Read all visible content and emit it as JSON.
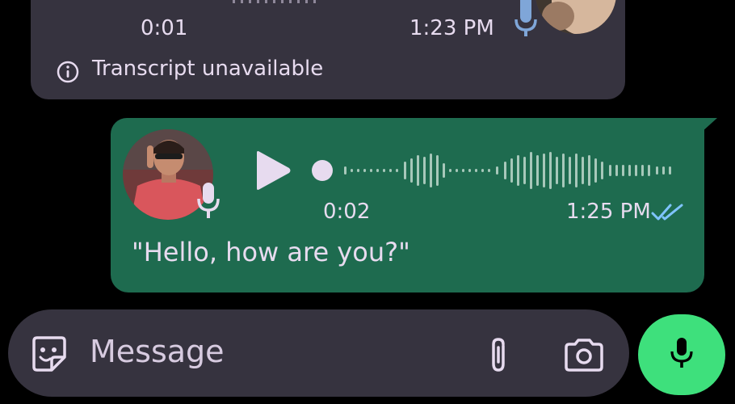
{
  "incoming_message": {
    "duration": "0:01",
    "time": "1:23 PM",
    "transcript_note": "Transcript unavailable",
    "icons": [
      "mic-icon",
      "info-icon"
    ]
  },
  "outgoing_message": {
    "duration": "0:02",
    "time": "1:25 PM",
    "transcript": "\"Hello, how are you?\"",
    "read_status": "double-check-icon",
    "icons": [
      "play-icon",
      "mic-icon",
      "double-check-icon"
    ]
  },
  "composer": {
    "placeholder": "Message",
    "icons": [
      "sticker-icon",
      "attach-icon",
      "camera-icon"
    ]
  },
  "mic_button": {
    "icon": "mic-icon"
  },
  "colors": {
    "background": "#000000",
    "incoming_bubble": "#36333f",
    "outgoing_bubble": "#1e6b4f",
    "accent_text": "#e7dbef",
    "fab": "#3ee07c",
    "read_check": "#7fc4ff"
  }
}
